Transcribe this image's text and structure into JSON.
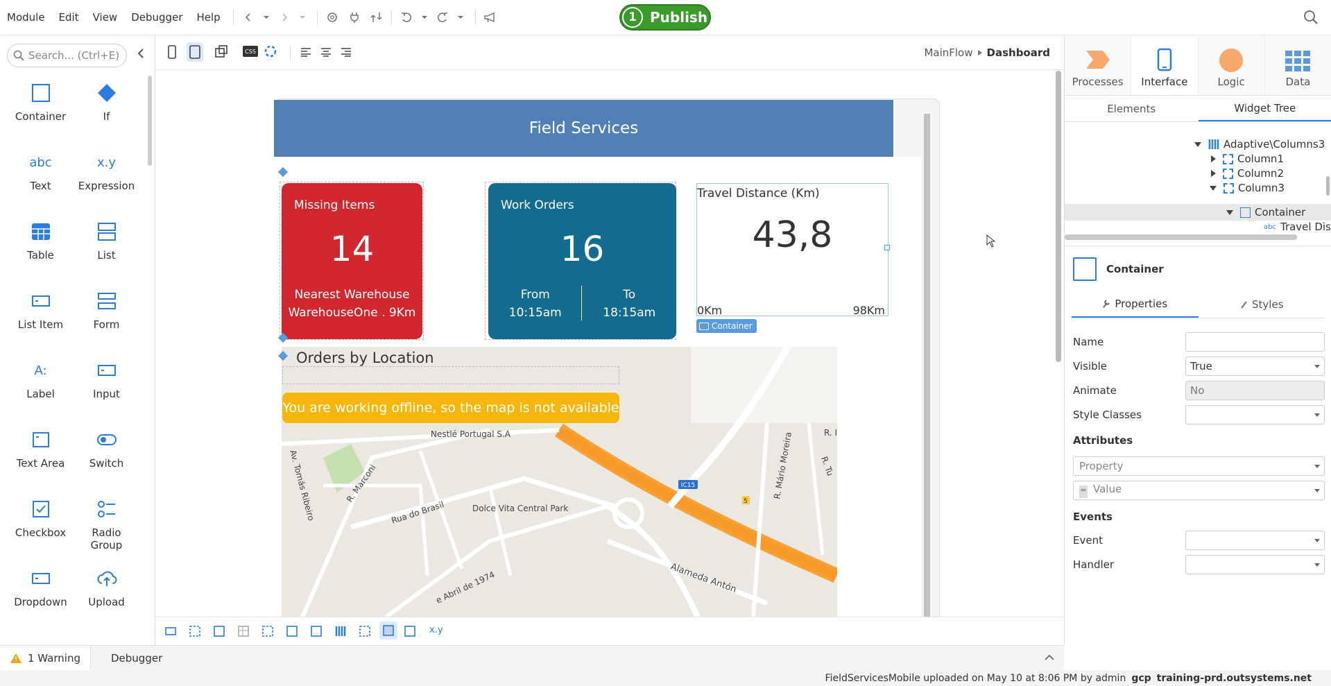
{
  "menu": [
    "Module",
    "Edit",
    "View",
    "Debugger",
    "Help"
  ],
  "publish": {
    "count": "1",
    "label": "Publish"
  },
  "search": {
    "placeholder": "Search... (Ctrl+E)"
  },
  "widgets": [
    {
      "label": "Container",
      "icon": "container-icon"
    },
    {
      "label": "If",
      "icon": "if-icon"
    },
    {
      "label": "Text",
      "icon": "text-icon"
    },
    {
      "label": "Expression",
      "icon": "expression-icon"
    },
    {
      "label": "Table",
      "icon": "table-icon"
    },
    {
      "label": "List",
      "icon": "list-icon"
    },
    {
      "label": "List Item",
      "icon": "list-item-icon"
    },
    {
      "label": "Form",
      "icon": "form-icon"
    },
    {
      "label": "Label",
      "icon": "label-icon"
    },
    {
      "label": "Input",
      "icon": "input-icon"
    },
    {
      "label": "Text Area",
      "icon": "text-area-icon"
    },
    {
      "label": "Switch",
      "icon": "switch-icon"
    },
    {
      "label": "Checkbox",
      "icon": "checkbox-icon"
    },
    {
      "label": "Radio Group",
      "icon": "radio-group-icon"
    },
    {
      "label": "Dropdown",
      "icon": "dropdown-icon"
    },
    {
      "label": "Upload",
      "icon": "upload-icon"
    }
  ],
  "breadcrumb": {
    "parent": "MainFlow",
    "current": "Dashboard"
  },
  "app": {
    "title": "Field Services",
    "missing": {
      "title": "Missing Items",
      "value": "14",
      "line1": "Nearest Warehouse",
      "line2": "WarehouseOne . 9Km"
    },
    "work": {
      "title": "Work Orders",
      "value": "16",
      "from_label": "From",
      "from_time": "10:15am",
      "to_label": "To",
      "to_time": "18:15am"
    },
    "travel": {
      "title": "Travel Distance (Km)",
      "value": "43,8",
      "min": "0Km",
      "max": "98Km"
    },
    "container_tag": "Container",
    "orders_title": "Orders by Location",
    "offline_msg": "You are working offline, so the map is not available"
  },
  "map_labels": {
    "nestle": "Nestlé Portugal S.A",
    "dolce": "Dolce Vita Central Park",
    "brasil": "Rua do Brasil",
    "marconi": "R. Marconi",
    "tomas": "Av. Tomás Ribeiro",
    "alameda": "Alameda Antón",
    "abril": "e Abril de 1974",
    "mario": "R. Mário Moreira",
    "ic15": "IC15",
    "r1": "R. I",
    "r2": "R. Tu",
    "exit": "5"
  },
  "right_tabs": [
    {
      "label": "Processes",
      "icon": "processes-icon"
    },
    {
      "label": "Interface",
      "icon": "interface-icon"
    },
    {
      "label": "Logic",
      "icon": "logic-icon"
    },
    {
      "label": "Data",
      "icon": "data-icon"
    }
  ],
  "sub_tabs": {
    "elements": "Elements",
    "widget_tree": "Widget Tree"
  },
  "tree": {
    "root": "Adaptive\\Columns3",
    "col1": "Column1",
    "col2": "Column2",
    "col3": "Column3",
    "container": "Container",
    "travel": "Travel Dis"
  },
  "props": {
    "header": "Container",
    "tab_properties": "Properties",
    "tab_styles": "Styles",
    "name_label": "Name",
    "name_value": "",
    "visible_label": "Visible",
    "visible_value": "True",
    "animate_label": "Animate",
    "animate_value": "No",
    "style_label": "Style Classes",
    "style_value": "",
    "attributes": "Attributes",
    "property_ph": "Property",
    "value_ph": "Value",
    "events": "Events",
    "event_label": "Event",
    "handler_label": "Handler"
  },
  "bottom": {
    "warning": "1 Warning",
    "debugger": "Debugger"
  },
  "status": {
    "text": "FieldServicesMobile uploaded on May 10 at 8:06 PM by admin",
    "env": "gcp",
    "server": "training-prd.outsystems.net"
  },
  "colors": {
    "red": "#d0282e",
    "blue": "#136b8f",
    "header": "#5180b6",
    "offline": "#f6b60b",
    "accent": "#2a7de1",
    "publish": "#3a9a2a"
  }
}
